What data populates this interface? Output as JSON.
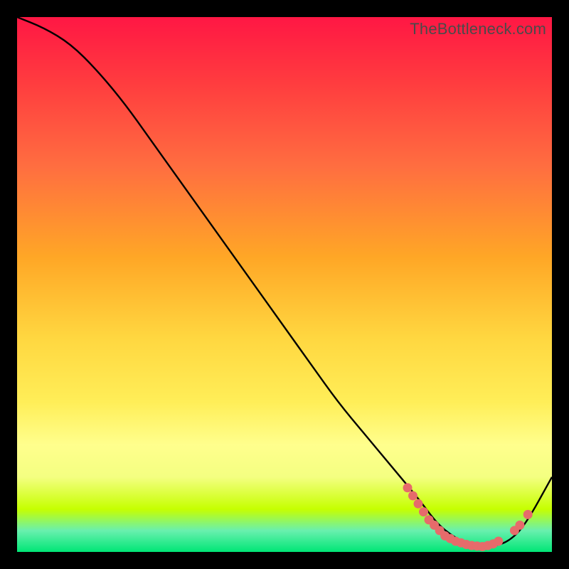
{
  "watermark": "TheBottleneck.com",
  "chart_data": {
    "type": "line",
    "title": "",
    "xlabel": "",
    "ylabel": "",
    "xlim": [
      0,
      100
    ],
    "ylim": [
      0,
      100
    ],
    "series": [
      {
        "name": "bottleneck-curve",
        "x": [
          0,
          5,
          10,
          15,
          20,
          25,
          30,
          35,
          40,
          45,
          50,
          55,
          60,
          65,
          70,
          75,
          78,
          80,
          83,
          86,
          89,
          92,
          95,
          100
        ],
        "y": [
          100,
          98,
          95,
          90,
          84,
          77,
          70,
          63,
          56,
          49,
          42,
          35,
          28,
          22,
          16,
          10,
          6,
          4,
          2,
          1,
          1,
          2,
          5,
          14
        ]
      }
    ],
    "markers": [
      {
        "x": 73,
        "y": 12
      },
      {
        "x": 74,
        "y": 10.5
      },
      {
        "x": 75,
        "y": 9
      },
      {
        "x": 76,
        "y": 7.5
      },
      {
        "x": 77,
        "y": 6
      },
      {
        "x": 78,
        "y": 5
      },
      {
        "x": 79,
        "y": 4
      },
      {
        "x": 80,
        "y": 3
      },
      {
        "x": 81,
        "y": 2.5
      },
      {
        "x": 82,
        "y": 2
      },
      {
        "x": 83,
        "y": 1.7
      },
      {
        "x": 84,
        "y": 1.4
      },
      {
        "x": 85,
        "y": 1.2
      },
      {
        "x": 86,
        "y": 1.1
      },
      {
        "x": 87,
        "y": 1.0
      },
      {
        "x": 88,
        "y": 1.2
      },
      {
        "x": 89,
        "y": 1.5
      },
      {
        "x": 90,
        "y": 2.0
      },
      {
        "x": 93,
        "y": 4.0
      },
      {
        "x": 94,
        "y": 5.0
      },
      {
        "x": 95.5,
        "y": 7.0
      }
    ],
    "colors": {
      "curve": "#000000",
      "marker": "#e66b6b"
    }
  }
}
